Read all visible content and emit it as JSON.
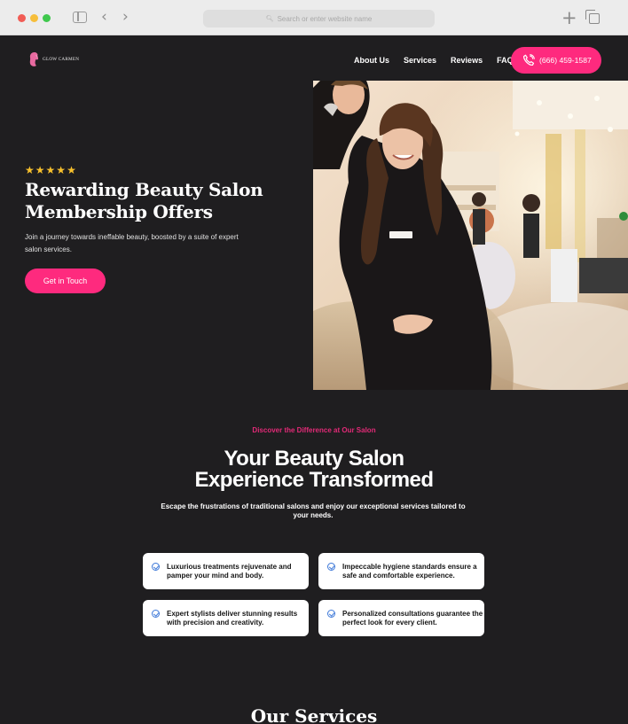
{
  "browser": {
    "address_placeholder": "Search or enter website name"
  },
  "brand": {
    "logo_text": "GLOW CARMEN",
    "accent_color": "#fe2a7e",
    "background_color": "#1f1e20"
  },
  "nav": {
    "items": [
      {
        "label": "About Us"
      },
      {
        "label": "Services"
      },
      {
        "label": "Reviews"
      },
      {
        "label": "FAQ"
      }
    ],
    "phone_label": "(666) 459-1587"
  },
  "hero": {
    "rating_stars": 5,
    "title_line1": "Rewarding Beauty Salon",
    "title_line2": "Membership Offers",
    "subtitle": "Join a journey towards ineffable beauty, boosted by a suite of expert salon services.",
    "cta_label": "Get in Touch",
    "image_icon": "salon-photo"
  },
  "difference": {
    "eyebrow": "Discover the Difference at Our Salon",
    "title_line1": "Your Beauty Salon",
    "title_line2": "Experience Transformed",
    "subtitle": "Escape the frustrations of traditional salons and enjoy our exceptional services tailored to your needs.",
    "features": [
      {
        "text": "Luxurious treatments rejuvenate and pamper your mind and body."
      },
      {
        "text": "Impeccable hygiene standards ensure a safe and comfortable experience."
      },
      {
        "text": "Expert stylists deliver stunning results with precision and creativity."
      },
      {
        "text": "Personalized consultations guarantee the perfect look for every client."
      }
    ]
  },
  "services": {
    "title": "Our Services"
  }
}
